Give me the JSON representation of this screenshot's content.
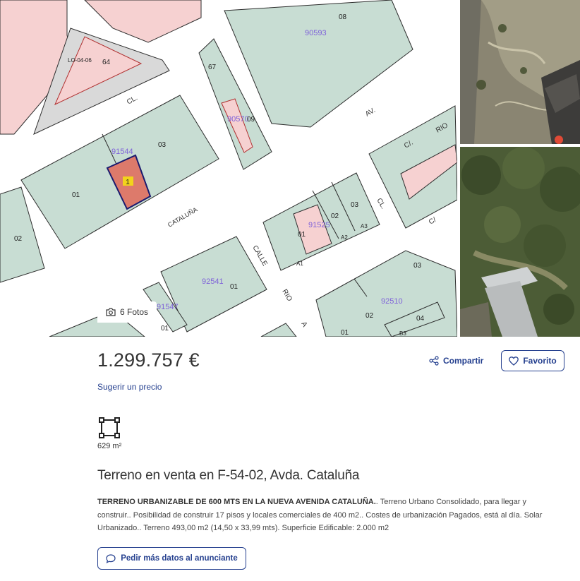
{
  "gallery": {
    "photos_label": "6 Fotos",
    "map_labels": {
      "parcels": [
        "90593",
        "91544",
        "90570",
        "91525",
        "92541",
        "92510",
        "91547"
      ],
      "numbers": [
        "08",
        "64",
        "67",
        "09",
        "03",
        "01",
        "02",
        "02",
        "03",
        "01",
        "A2",
        "A3",
        "A1",
        "01",
        "03",
        "02",
        "04",
        "B3",
        "01",
        "01",
        "1"
      ],
      "streets": [
        "CL.",
        "AV.",
        "RIO",
        "C/.",
        "CL.",
        "C/",
        "CATALUÑA",
        "CALLE",
        "RIO",
        "A"
      ],
      "lot_code": "LO-04-06"
    }
  },
  "listing": {
    "price": "1.299.757 €",
    "suggest_price": "Sugerir un precio",
    "share_label": "Compartir",
    "favorite_label": "Favorito",
    "area": "629 m²",
    "title": "Terreno en venta en F-54-02, Avda. Cataluña",
    "description_bold": "TERRENO URBANIZABLE DE 600 MTS EN LA NUEVA AVENIDA CATALUÑA.",
    "description_rest": ". Terreno Urbano Consolidado, para llegar y construir.. Posibilidad de construir 17 pisos y locales comerciales de 400 m2.. Costes de urbanización Pagados, está al día. Solar Urbanizado.. Terreno 493,00 m2 (14,50 x 33,99 mts). Superficie Edificable: 2.000 m2",
    "contact_label": "Pedir más datos al anunciante"
  },
  "icons": {
    "camera": "camera-icon",
    "share": "share-icon",
    "heart": "heart-icon",
    "area": "area-icon",
    "chat": "chat-icon"
  },
  "colors": {
    "accent": "#25408f",
    "block_green": "#c8ddd3",
    "block_pink": "#f6d1d1",
    "parcel_label": "#7f62d9",
    "highlight_parcel": "#dd7a6b",
    "highlight_tag": "#f2d31b"
  }
}
